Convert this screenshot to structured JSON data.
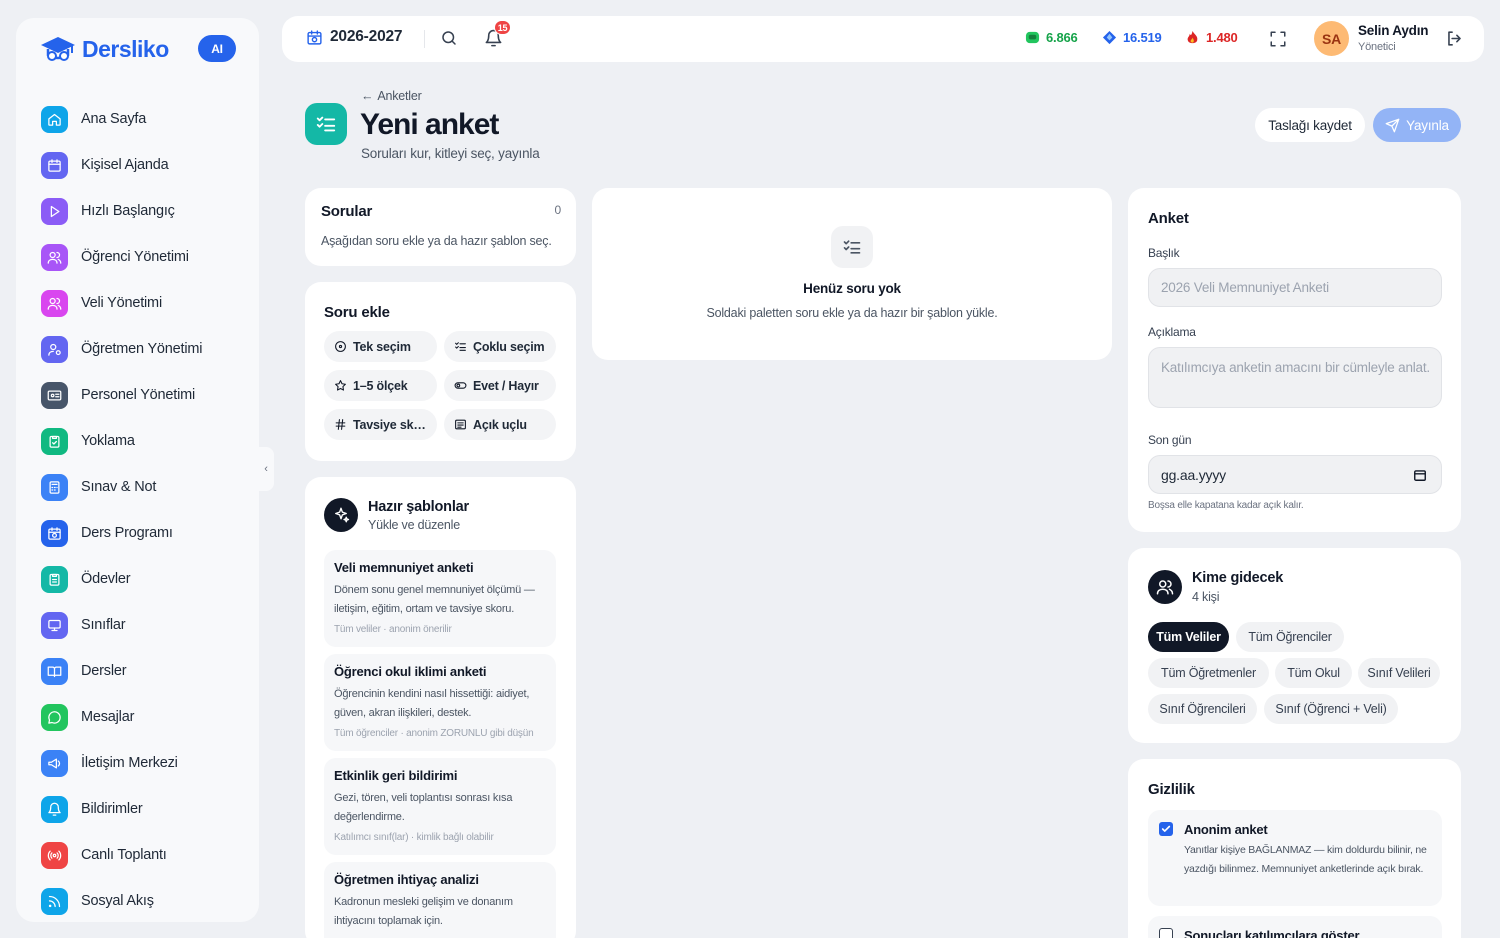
{
  "app": {
    "name": "Dersliko",
    "ai_badge": "AI"
  },
  "sidebar": {
    "items": [
      {
        "label": "Ana Sayfa",
        "icon": "home-icon",
        "color": "#0ea5e9"
      },
      {
        "label": "Kişisel Ajanda",
        "icon": "calendar-icon",
        "color": "#6366f1"
      },
      {
        "label": "Hızlı Başlangıç",
        "icon": "play-icon",
        "color": "#8b5cf6"
      },
      {
        "label": "Öğrenci Yönetimi",
        "icon": "users-icon",
        "color": "#a855f7"
      },
      {
        "label": "Veli Yönetimi",
        "icon": "users-icon",
        "color": "#d946ef"
      },
      {
        "label": "Öğretmen Yönetimi",
        "icon": "user-cog-icon",
        "color": "#6366f1"
      },
      {
        "label": "Personel Yönetimi",
        "icon": "id-card-icon",
        "color": "#475569"
      },
      {
        "label": "Yoklama",
        "icon": "clipboard-check-icon",
        "color": "#10b981"
      },
      {
        "label": "Sınav & Not",
        "icon": "calculator-icon",
        "color": "#3b82f6"
      },
      {
        "label": "Ders Programı",
        "icon": "calendar-clock-icon",
        "color": "#2563eb"
      },
      {
        "label": "Ödevler",
        "icon": "clipboard-list-icon",
        "color": "#14b8a6"
      },
      {
        "label": "Sınıflar",
        "icon": "monitor-icon",
        "color": "#6366f1"
      },
      {
        "label": "Dersler",
        "icon": "book-open-icon",
        "color": "#3b82f6"
      },
      {
        "label": "Mesajlar",
        "icon": "message-circle-icon",
        "color": "#22c55e"
      },
      {
        "label": "İletişim Merkezi",
        "icon": "megaphone-icon",
        "color": "#3b82f6"
      },
      {
        "label": "Bildirimler",
        "icon": "bell-icon",
        "color": "#0ea5e9"
      },
      {
        "label": "Canlı Toplantı",
        "icon": "radio-icon",
        "color": "#ef4444"
      },
      {
        "label": "Sosyal Akış",
        "icon": "rss-icon",
        "color": "#0ea5e9"
      }
    ]
  },
  "topbar": {
    "year": "2026-2027",
    "notification_count": "15",
    "stats": [
      {
        "value": "6.866",
        "icon": "gem-icon",
        "color": "#16a34a"
      },
      {
        "value": "16.519",
        "icon": "gem-icon",
        "color": "#2563eb"
      },
      {
        "value": "1.480",
        "icon": "flame-icon",
        "color": "#dc2626"
      }
    ],
    "user": {
      "initials": "SA",
      "name": "Selin Aydın",
      "role": "Yönetici"
    }
  },
  "header": {
    "breadcrumb": "Anketler",
    "title": "Yeni anket",
    "subtitle": "Soruları kur, kitleyi seç, yayınla",
    "draft_label": "Taslağı kaydet",
    "publish_label": "Yayınla"
  },
  "questions": {
    "title": "Sorular",
    "count": "0",
    "hint": "Aşağıdan soru ekle ya da hazır şablon seç."
  },
  "add_question": {
    "title": "Soru ekle",
    "types": [
      {
        "label": "Tek seçim",
        "icon": "circle-dot-icon"
      },
      {
        "label": "Çoklu seçim",
        "icon": "list-checks-icon"
      },
      {
        "label": "1–5 ölçek",
        "icon": "star-icon"
      },
      {
        "label": "Evet / Hayır",
        "icon": "toggle-icon"
      },
      {
        "label": "Tavsiye skoru",
        "icon": "hash-icon"
      },
      {
        "label": "Açık uçlu",
        "icon": "text-icon"
      }
    ]
  },
  "templates": {
    "title": "Hazır şablonlar",
    "subtitle": "Yükle ve düzenle",
    "items": [
      {
        "title": "Veli memnuniyet anketi",
        "desc": "Dönem sonu genel memnuniyet ölçümü — iletişim, eğitim, ortam ve tavsiye skoru.",
        "meta": "Tüm veliler · anonim önerilir"
      },
      {
        "title": "Öğrenci okul iklimi anketi",
        "desc": "Öğrencinin kendini nasıl hissettiği: aidiyet, güven, akran ilişkileri, destek.",
        "meta": "Tüm öğrenciler · anonim ZORUNLU gibi düşün"
      },
      {
        "title": "Etkinlik geri bildirimi",
        "desc": "Gezi, tören, veli toplantısı sonrası kısa değerlendirme.",
        "meta": "Katılımcı sınıf(lar) · kimlik bağlı olabilir"
      },
      {
        "title": "Öğretmen ihtiyaç analizi",
        "desc": "Kadronun mesleki gelişim ve donanım ihtiyacını toplamak için.",
        "meta": ""
      }
    ]
  },
  "empty_state": {
    "title": "Henüz soru yok",
    "desc": "Soldaki paletten soru ekle ya da hazır bir şablon yükle."
  },
  "survey": {
    "title": "Anket",
    "title_label": "Başlık",
    "title_placeholder": "2026 Veli Memnuniyet Anketi",
    "desc_label": "Açıklama",
    "desc_placeholder": "Katılımcıya anketin amacını bir cümleyle anlat.",
    "deadline_label": "Son gün",
    "deadline_placeholder": "gg.aa.yyyy",
    "deadline_hint": "Boşsa elle kapatana kadar açık kalır."
  },
  "audience": {
    "title": "Kime gidecek",
    "count": "4 kişi",
    "options": [
      {
        "label": "Tüm Veliler",
        "active": true
      },
      {
        "label": "Tüm Öğrenciler",
        "active": false
      },
      {
        "label": "Tüm Öğretmenler",
        "active": false
      },
      {
        "label": "Tüm Okul",
        "active": false
      },
      {
        "label": "Sınıf Velileri",
        "active": false
      },
      {
        "label": "Sınıf Öğrencileri",
        "active": false
      },
      {
        "label": "Sınıf (Öğrenci + Veli)",
        "active": false
      }
    ]
  },
  "privacy": {
    "title": "Gizlilik",
    "anonymous_label": "Anonim anket",
    "anonymous_checked": true,
    "anonymous_desc": "Yanıtlar kişiye BAĞLANMAZ — kim doldurdu bilinir, ne yazdığı bilinmez. Memnuniyet anketlerinde açık bırak.",
    "show_results_label": "Sonuçları katılımcılara göster"
  }
}
